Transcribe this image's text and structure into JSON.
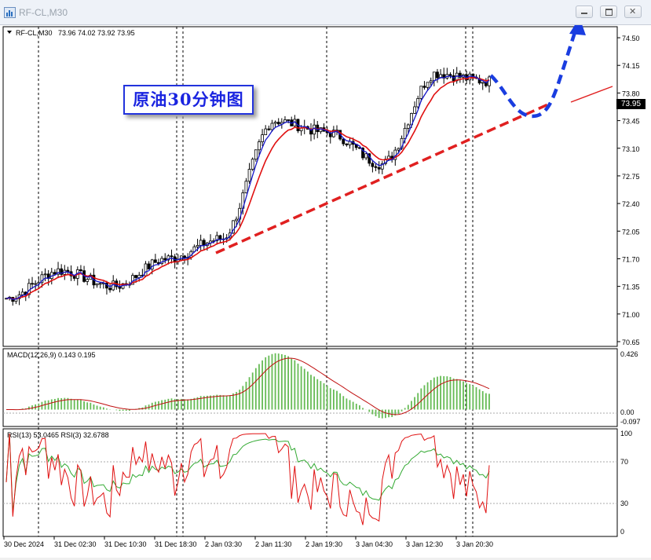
{
  "window": {
    "title": "RF-CL,M30",
    "icon": "chart-window-icon",
    "buttons": [
      {
        "name": "minimize-button",
        "icon": "minimize-icon"
      },
      {
        "name": "restore-button",
        "icon": "restore-icon"
      },
      {
        "name": "close-button",
        "icon": "close-icon"
      }
    ]
  },
  "header": {
    "symbol": "RF-CL,M30",
    "ohlc": "73.96 74.02 73.92 73.95"
  },
  "overlay_label": "原油30分钟图",
  "current_price": "73.95",
  "price_axis": [
    "74.50",
    "74.15",
    "73.80",
    "73.45",
    "73.10",
    "72.75",
    "72.40",
    "72.05",
    "71.70",
    "71.35",
    "71.00",
    "70.65"
  ],
  "time_axis": [
    "30 Dec 2024",
    "31 Dec 02:30",
    "31 Dec 10:30",
    "31 Dec 18:30",
    "2 Jan 03:30",
    "2 Jan 11:30",
    "2 Jan 19:30",
    "3 Jan 04:30",
    "3 Jan 12:30",
    "3 Jan 20:30"
  ],
  "macd": {
    "label": "MACD(12,26,9) 0.143 0.195",
    "axis": [
      "0.426",
      "0.00",
      "-0.097"
    ]
  },
  "rsi": {
    "label": "RSI(13) 53.0465  RSI(3) 32.6788",
    "axis": [
      "100",
      "70",
      "30",
      "0"
    ]
  },
  "colors": {
    "fast_ma": "#1515c8",
    "slow_ma": "#e01010",
    "trendline": "#e02020",
    "forecast": "#1a3de0",
    "macd_hist": "#66bb55",
    "rsi_slow": "#33aa33",
    "rsi_fast": "#e01010"
  },
  "chart_data": {
    "type": "line",
    "title": "原油30分钟图",
    "x": [
      "30 Dec 2024",
      "31 Dec 02:30",
      "31 Dec 10:30",
      "31 Dec 18:30",
      "2 Jan 03:30",
      "2 Jan 11:30",
      "2 Jan 19:30",
      "3 Jan 04:30",
      "3 Jan 12:30",
      "3 Jan 20:30"
    ],
    "ylim": [
      70.6,
      74.6
    ],
    "series": [
      {
        "values": [
          71.2,
          71.55,
          71.35,
          71.7,
          71.95,
          73.45,
          73.3,
          72.9,
          74.05,
          73.95
        ]
      }
    ],
    "last": {
      "open": 73.96,
      "high": 74.02,
      "low": 73.92,
      "close": 73.95
    },
    "grid": false
  }
}
